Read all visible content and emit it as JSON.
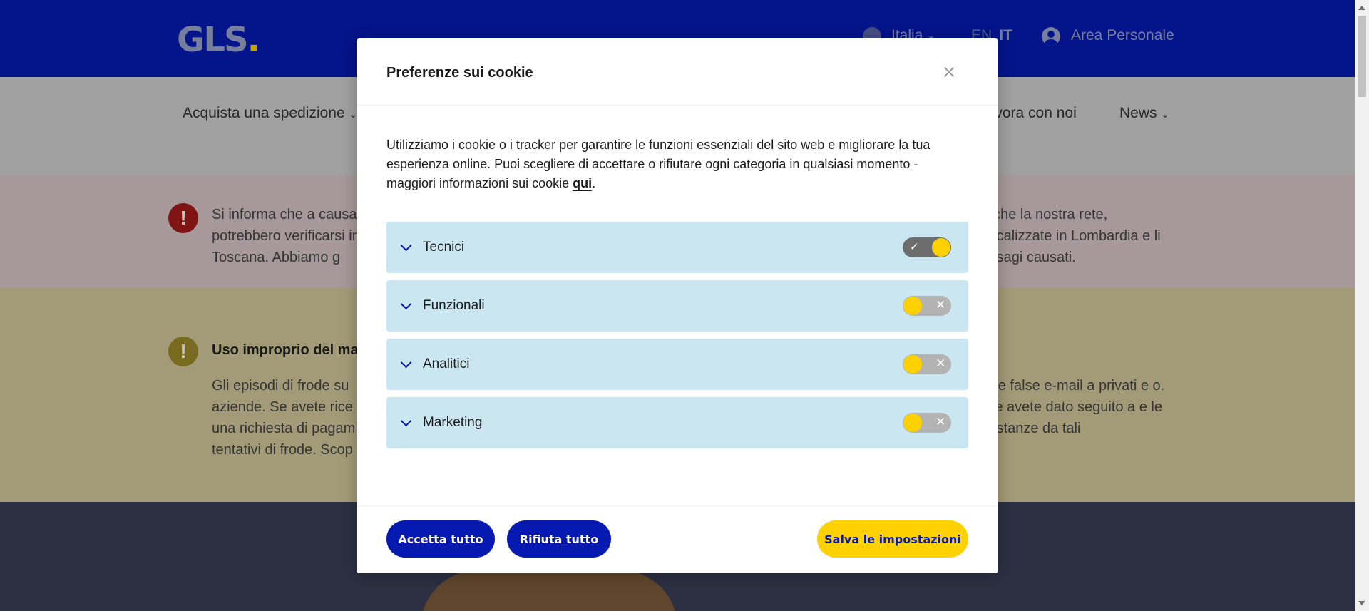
{
  "site": {
    "logo": "GLS",
    "logo_dot": ".",
    "country": "Italia",
    "lang_en": "EN",
    "lang_it": "IT",
    "area_personale": "Area Personale",
    "nav": {
      "spedizione": "Acquista una spedizione",
      "lavora": "Lavora con noi",
      "news": "News",
      "caret": "⌄"
    },
    "alert_red": {
      "left": "Si informa che a causa potrebbero verificarsi in Toscana. Abbiamo g",
      "right": "nche la nostra rete, localizzate in Lombardia e li disagi causati."
    },
    "alert_yellow": {
      "title": "Uso improprio del ma",
      "left": "Gli episodi di frode su aziende. Se avete rice una richiesta di pagam tentativi di frode. Scop",
      "right": "are false e-mail a privati e o. Se avete dato seguito a e le distanze da tali"
    }
  },
  "modal": {
    "title": "Preferenze sui cookie",
    "description": "Utilizziamo i cookie o i tracker per garantire le funzioni essenziali del sito web e migliorare la tua esperienza online. Puoi scegliere di accettare o rifiutare ogni categoria in qualsiasi momento - maggiori informazioni sui cookie ",
    "link_text": "qui",
    "description_end": ".",
    "categories": [
      {
        "label": "Tecnici",
        "enabled": true
      },
      {
        "label": "Funzionali",
        "enabled": false
      },
      {
        "label": "Analitici",
        "enabled": false
      },
      {
        "label": "Marketing",
        "enabled": false
      }
    ],
    "toggle_check": "✓",
    "toggle_x": "✕",
    "buttons": {
      "accept_all": "Accetta tutto",
      "reject_all": "Rifiuta tutto",
      "save": "Salva le impostazioni"
    }
  },
  "colors": {
    "brand_blue": "#061ab1",
    "brand_yellow": "#ffd100",
    "category_bg": "#cae6f1"
  },
  "icons": {
    "close": "close-icon",
    "chevron": "chevron-down-icon",
    "globe": "globe-icon",
    "user": "user-icon"
  }
}
